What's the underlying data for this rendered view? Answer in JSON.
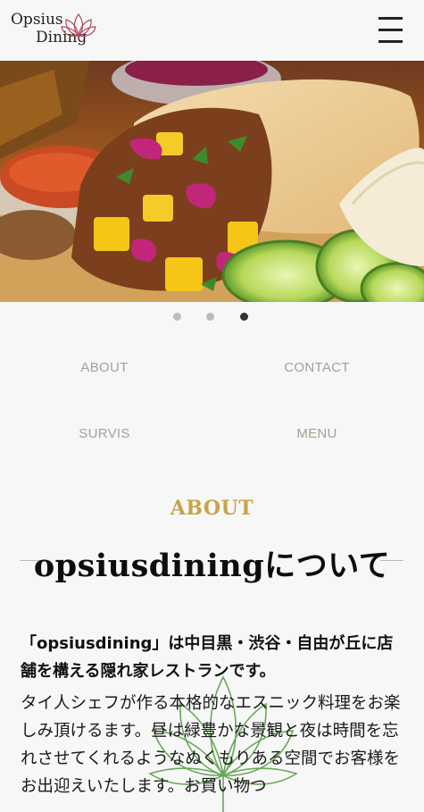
{
  "header": {
    "logo_line1": "Opsius",
    "logo_line2": "Dining",
    "menu_icon": "hamburger-menu-icon"
  },
  "hero": {
    "description_icon": "burrito-photo"
  },
  "carousel": {
    "slide_count": 3,
    "active_index": 2
  },
  "nav": {
    "about": "ABOUT",
    "contact": "CONTACT",
    "survis": "SURVIS",
    "menu": "MENU"
  },
  "about_section": {
    "label": "ABOUT",
    "title": "opsiusdiningについて",
    "lead": "「opsiusdining」は中目黒・渋谷・自由が丘に店舗を構える隠れ家レストランです。",
    "body": "タイ人シェフが作る本格的なエスニック料理をお楽しみ頂けるます。昼は緑豊かな景観と夜は時間を忘れさせてくれるようなぬくもりある空間でお客様をお出迎えいたします。お買い物つ"
  },
  "colors": {
    "accent_gold": "#c8a34a",
    "nav_text": "#a99f92",
    "dot_active": "#333333",
    "dot_inactive": "#bcbcbc",
    "background": "#f7f7f7"
  }
}
